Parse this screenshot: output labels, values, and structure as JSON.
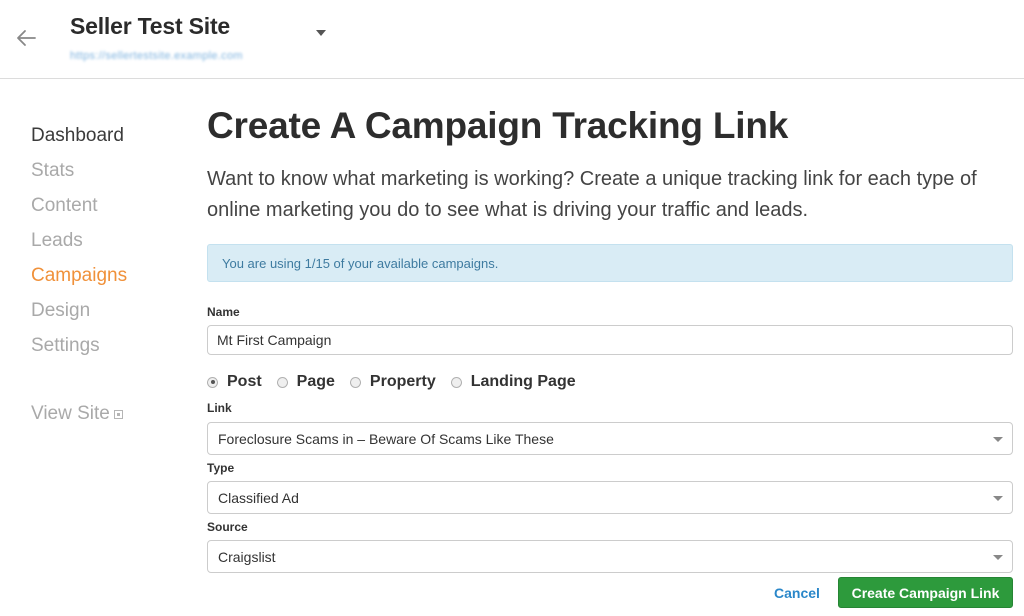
{
  "header": {
    "site_title": "Seller Test Site",
    "site_url": "https://sellertestsite.example.com"
  },
  "sidebar": {
    "items": [
      {
        "label": "Dashboard"
      },
      {
        "label": "Stats"
      },
      {
        "label": "Content"
      },
      {
        "label": "Leads"
      },
      {
        "label": "Campaigns"
      },
      {
        "label": "Design"
      },
      {
        "label": "Settings"
      }
    ],
    "view_site": "View Site"
  },
  "main": {
    "title": "Create A Campaign Tracking Link",
    "description": "Want to know what marketing is working? Create a unique tracking link for each type of online marketing you do to see what is driving your traffic and leads.",
    "alert": "You are using 1/15 of your available campaigns.",
    "name_label": "Name",
    "name_value": "Mt First Campaign",
    "content_types": [
      "Post",
      "Page",
      "Property",
      "Landing Page"
    ],
    "link_label": "Link",
    "link_value": "Foreclosure Scams in – Beware Of Scams Like These",
    "type_label": "Type",
    "type_value": "Classified Ad",
    "source_label": "Source",
    "source_value": "Craigslist",
    "cancel_label": "Cancel",
    "submit_label": "Create Campaign Link"
  },
  "colors": {
    "accent_orange": "#f0913a",
    "primary_green": "#2d9a3c",
    "link_blue": "#2a87c9",
    "alert_bg": "#d9ecf5"
  }
}
